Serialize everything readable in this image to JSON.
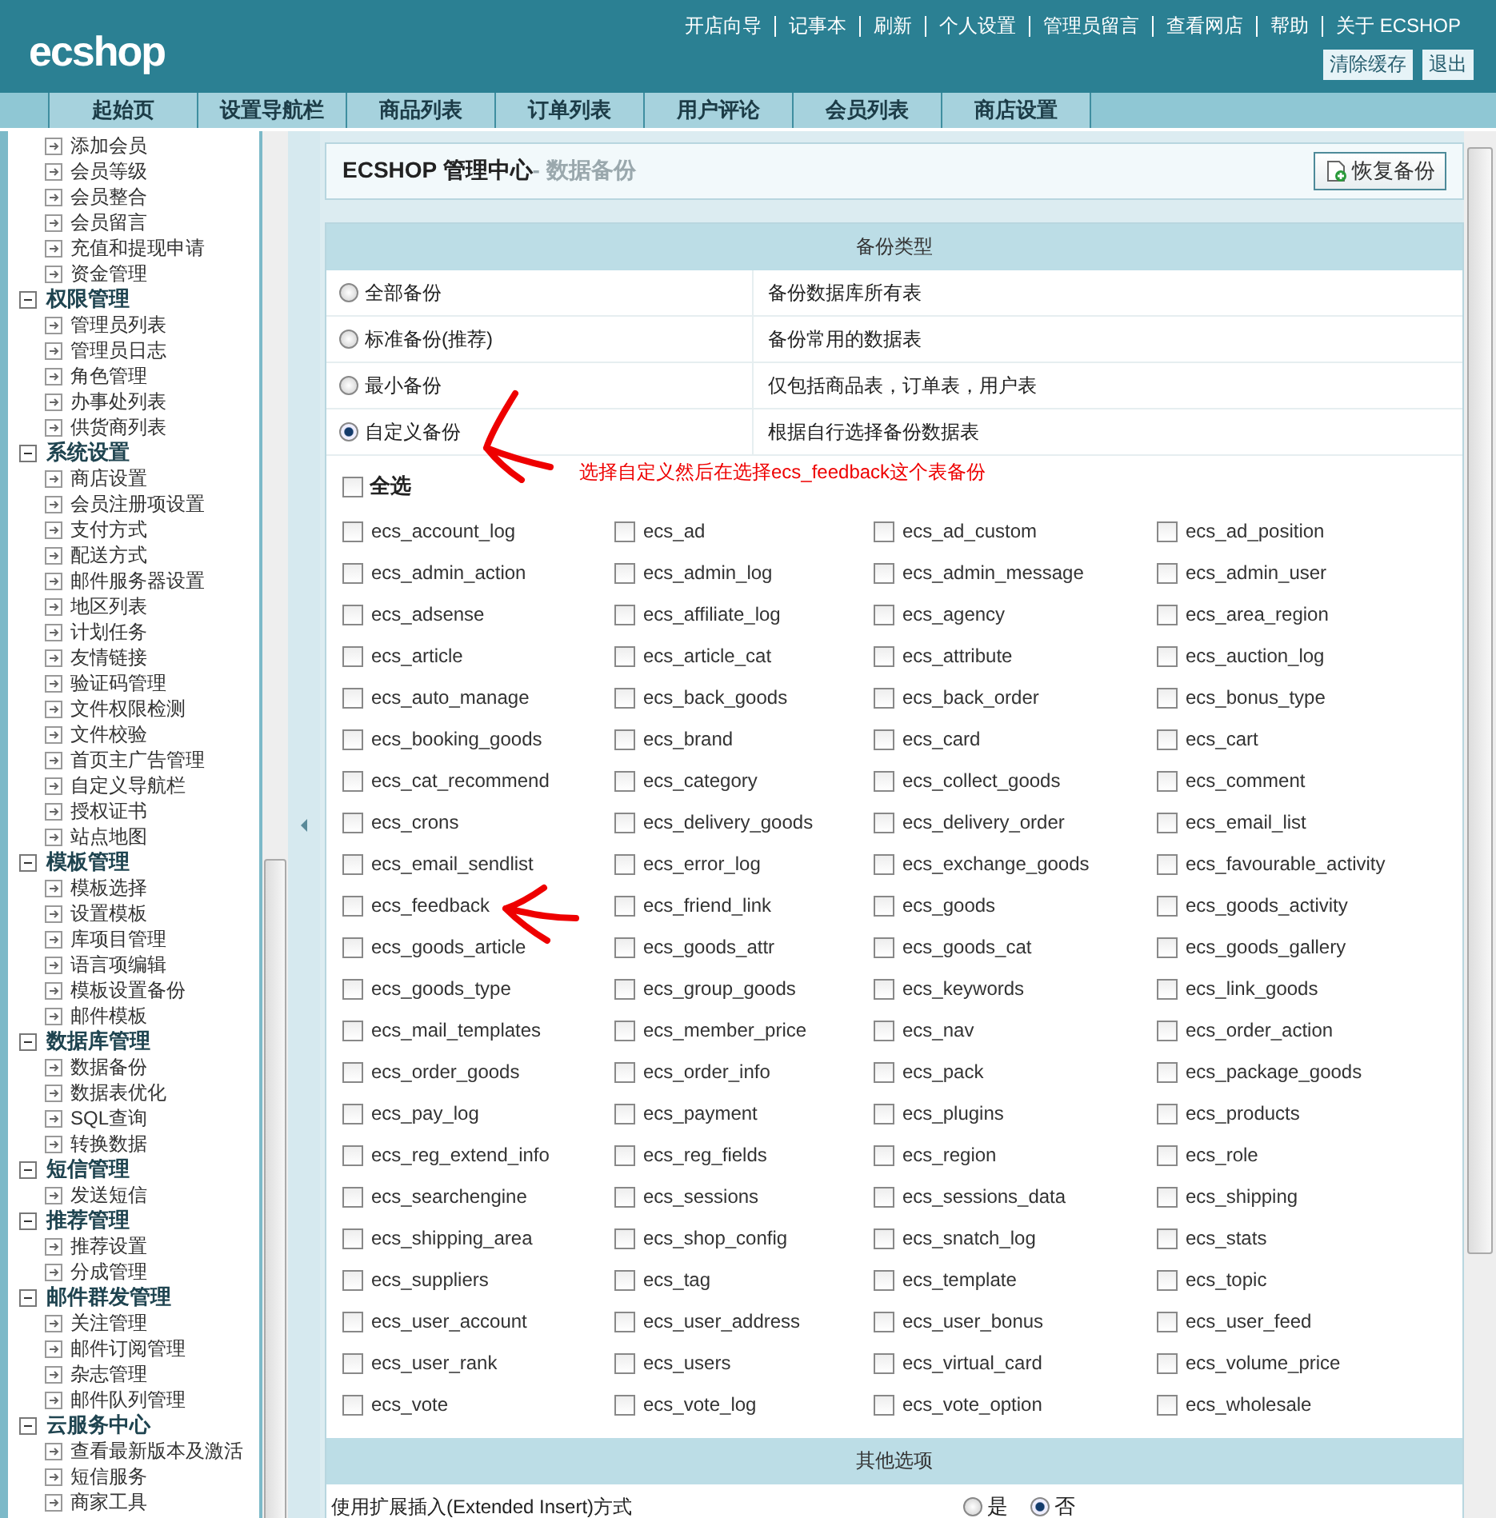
{
  "header": {
    "logo": "ecshop",
    "links": [
      "开店向导",
      "记事本",
      "刷新",
      "个人设置",
      "管理员留言",
      "查看网店",
      "帮助",
      "关于 ECSHOP"
    ],
    "buttons": [
      "清除缓存",
      "退出"
    ]
  },
  "nav_tabs": [
    {
      "label": "起始页"
    },
    {
      "label": "设置导航栏"
    },
    {
      "label": "商品列表"
    },
    {
      "label": "订单列表"
    },
    {
      "label": "用户评论"
    },
    {
      "label": "会员列表"
    },
    {
      "label": "商店设置"
    }
  ],
  "sidebar": {
    "top_items": [
      "添加会员",
      "会员等级",
      "会员整合",
      "会员留言",
      "充值和提现申请",
      "资金管理"
    ],
    "groups": [
      {
        "title": "权限管理",
        "children": [
          "管理员列表",
          "管理员日志",
          "角色管理",
          "办事处列表",
          "供货商列表"
        ]
      },
      {
        "title": "系统设置",
        "children": [
          "商店设置",
          "会员注册项设置",
          "支付方式",
          "配送方式",
          "邮件服务器设置",
          "地区列表",
          "计划任务",
          "友情链接",
          "验证码管理",
          "文件权限检测",
          "文件校验",
          "首页主广告管理",
          "自定义导航栏",
          "授权证书",
          "站点地图"
        ]
      },
      {
        "title": "模板管理",
        "children": [
          "模板选择",
          "设置模板",
          "库项目管理",
          "语言项编辑",
          "模板设置备份",
          "邮件模板"
        ]
      },
      {
        "title": "数据库管理",
        "children": [
          "数据备份",
          "数据表优化",
          "SQL查询",
          "转换数据"
        ]
      },
      {
        "title": "短信管理",
        "children": [
          "发送短信"
        ]
      },
      {
        "title": "推荐管理",
        "children": [
          "推荐设置",
          "分成管理"
        ]
      },
      {
        "title": "邮件群发管理",
        "children": [
          "关注管理",
          "邮件订阅管理",
          "杂志管理",
          "邮件队列管理"
        ]
      },
      {
        "title": "云服务中心",
        "children": [
          "查看最新版本及激活",
          "短信服务",
          "商家工具"
        ]
      }
    ]
  },
  "page_title": {
    "main": "ECSHOP 管理中心",
    "sub": "- 数据备份"
  },
  "action_button": "恢复备份",
  "backup_types": {
    "heading": "备份类型",
    "options": [
      {
        "label": "全部备份",
        "description": "备份数据库所有表",
        "selected": false
      },
      {
        "label": "标准备份(推荐)",
        "description": "备份常用的数据表",
        "selected": false
      },
      {
        "label": "最小备份",
        "description": "仅包括商品表，订单表，用户表",
        "selected": false
      },
      {
        "label": "自定义备份",
        "description": "根据自行选择备份数据表",
        "selected": true
      }
    ]
  },
  "annotation": "选择自定义然后在选择ecs_feedback这个表备份",
  "select_all": {
    "label": "全选",
    "checked": false
  },
  "tables": [
    {
      "name": "ecs_account_log",
      "checked": false
    },
    {
      "name": "ecs_ad",
      "checked": false
    },
    {
      "name": "ecs_ad_custom",
      "checked": false
    },
    {
      "name": "ecs_ad_position",
      "checked": false
    },
    {
      "name": "ecs_admin_action",
      "checked": false
    },
    {
      "name": "ecs_admin_log",
      "checked": false
    },
    {
      "name": "ecs_admin_message",
      "checked": false
    },
    {
      "name": "ecs_admin_user",
      "checked": false
    },
    {
      "name": "ecs_adsense",
      "checked": false
    },
    {
      "name": "ecs_affiliate_log",
      "checked": false
    },
    {
      "name": "ecs_agency",
      "checked": false
    },
    {
      "name": "ecs_area_region",
      "checked": false
    },
    {
      "name": "ecs_article",
      "checked": false
    },
    {
      "name": "ecs_article_cat",
      "checked": false
    },
    {
      "name": "ecs_attribute",
      "checked": false
    },
    {
      "name": "ecs_auction_log",
      "checked": false
    },
    {
      "name": "ecs_auto_manage",
      "checked": false
    },
    {
      "name": "ecs_back_goods",
      "checked": false
    },
    {
      "name": "ecs_back_order",
      "checked": false
    },
    {
      "name": "ecs_bonus_type",
      "checked": false
    },
    {
      "name": "ecs_booking_goods",
      "checked": false
    },
    {
      "name": "ecs_brand",
      "checked": false
    },
    {
      "name": "ecs_card",
      "checked": false
    },
    {
      "name": "ecs_cart",
      "checked": false
    },
    {
      "name": "ecs_cat_recommend",
      "checked": false
    },
    {
      "name": "ecs_category",
      "checked": false
    },
    {
      "name": "ecs_collect_goods",
      "checked": false
    },
    {
      "name": "ecs_comment",
      "checked": false
    },
    {
      "name": "ecs_crons",
      "checked": false
    },
    {
      "name": "ecs_delivery_goods",
      "checked": false
    },
    {
      "name": "ecs_delivery_order",
      "checked": false
    },
    {
      "name": "ecs_email_list",
      "checked": false
    },
    {
      "name": "ecs_email_sendlist",
      "checked": false
    },
    {
      "name": "ecs_error_log",
      "checked": false
    },
    {
      "name": "ecs_exchange_goods",
      "checked": false
    },
    {
      "name": "ecs_favourable_activity",
      "checked": false
    },
    {
      "name": "ecs_feedback",
      "checked": false
    },
    {
      "name": "ecs_friend_link",
      "checked": false
    },
    {
      "name": "ecs_goods",
      "checked": false
    },
    {
      "name": "ecs_goods_activity",
      "checked": false
    },
    {
      "name": "ecs_goods_article",
      "checked": false
    },
    {
      "name": "ecs_goods_attr",
      "checked": false
    },
    {
      "name": "ecs_goods_cat",
      "checked": false
    },
    {
      "name": "ecs_goods_gallery",
      "checked": false
    },
    {
      "name": "ecs_goods_type",
      "checked": false
    },
    {
      "name": "ecs_group_goods",
      "checked": false
    },
    {
      "name": "ecs_keywords",
      "checked": false
    },
    {
      "name": "ecs_link_goods",
      "checked": false
    },
    {
      "name": "ecs_mail_templates",
      "checked": false
    },
    {
      "name": "ecs_member_price",
      "checked": false
    },
    {
      "name": "ecs_nav",
      "checked": false
    },
    {
      "name": "ecs_order_action",
      "checked": false
    },
    {
      "name": "ecs_order_goods",
      "checked": false
    },
    {
      "name": "ecs_order_info",
      "checked": false
    },
    {
      "name": "ecs_pack",
      "checked": false
    },
    {
      "name": "ecs_package_goods",
      "checked": false
    },
    {
      "name": "ecs_pay_log",
      "checked": false
    },
    {
      "name": "ecs_payment",
      "checked": false
    },
    {
      "name": "ecs_plugins",
      "checked": false
    },
    {
      "name": "ecs_products",
      "checked": false
    },
    {
      "name": "ecs_reg_extend_info",
      "checked": false
    },
    {
      "name": "ecs_reg_fields",
      "checked": false
    },
    {
      "name": "ecs_region",
      "checked": false
    },
    {
      "name": "ecs_role",
      "checked": false
    },
    {
      "name": "ecs_searchengine",
      "checked": false
    },
    {
      "name": "ecs_sessions",
      "checked": false
    },
    {
      "name": "ecs_sessions_data",
      "checked": false
    },
    {
      "name": "ecs_shipping",
      "checked": false
    },
    {
      "name": "ecs_shipping_area",
      "checked": false
    },
    {
      "name": "ecs_shop_config",
      "checked": false
    },
    {
      "name": "ecs_snatch_log",
      "checked": false
    },
    {
      "name": "ecs_stats",
      "checked": false
    },
    {
      "name": "ecs_suppliers",
      "checked": false
    },
    {
      "name": "ecs_tag",
      "checked": false
    },
    {
      "name": "ecs_template",
      "checked": false
    },
    {
      "name": "ecs_topic",
      "checked": false
    },
    {
      "name": "ecs_user_account",
      "checked": false
    },
    {
      "name": "ecs_user_address",
      "checked": false
    },
    {
      "name": "ecs_user_bonus",
      "checked": false
    },
    {
      "name": "ecs_user_feed",
      "checked": false
    },
    {
      "name": "ecs_user_rank",
      "checked": false
    },
    {
      "name": "ecs_users",
      "checked": false
    },
    {
      "name": "ecs_virtual_card",
      "checked": false
    },
    {
      "name": "ecs_volume_price",
      "checked": false
    },
    {
      "name": "ecs_vote",
      "checked": false
    },
    {
      "name": "ecs_vote_log",
      "checked": false
    },
    {
      "name": "ecs_vote_option",
      "checked": false
    },
    {
      "name": "ecs_wholesale",
      "checked": false
    }
  ],
  "other_options": {
    "heading": "其他选项",
    "rows": [
      {
        "label": "使用扩展插入(Extended Insert)方式",
        "choices": [
          {
            "label": "是",
            "selected": false
          },
          {
            "label": "否",
            "selected": true
          }
        ]
      }
    ]
  }
}
